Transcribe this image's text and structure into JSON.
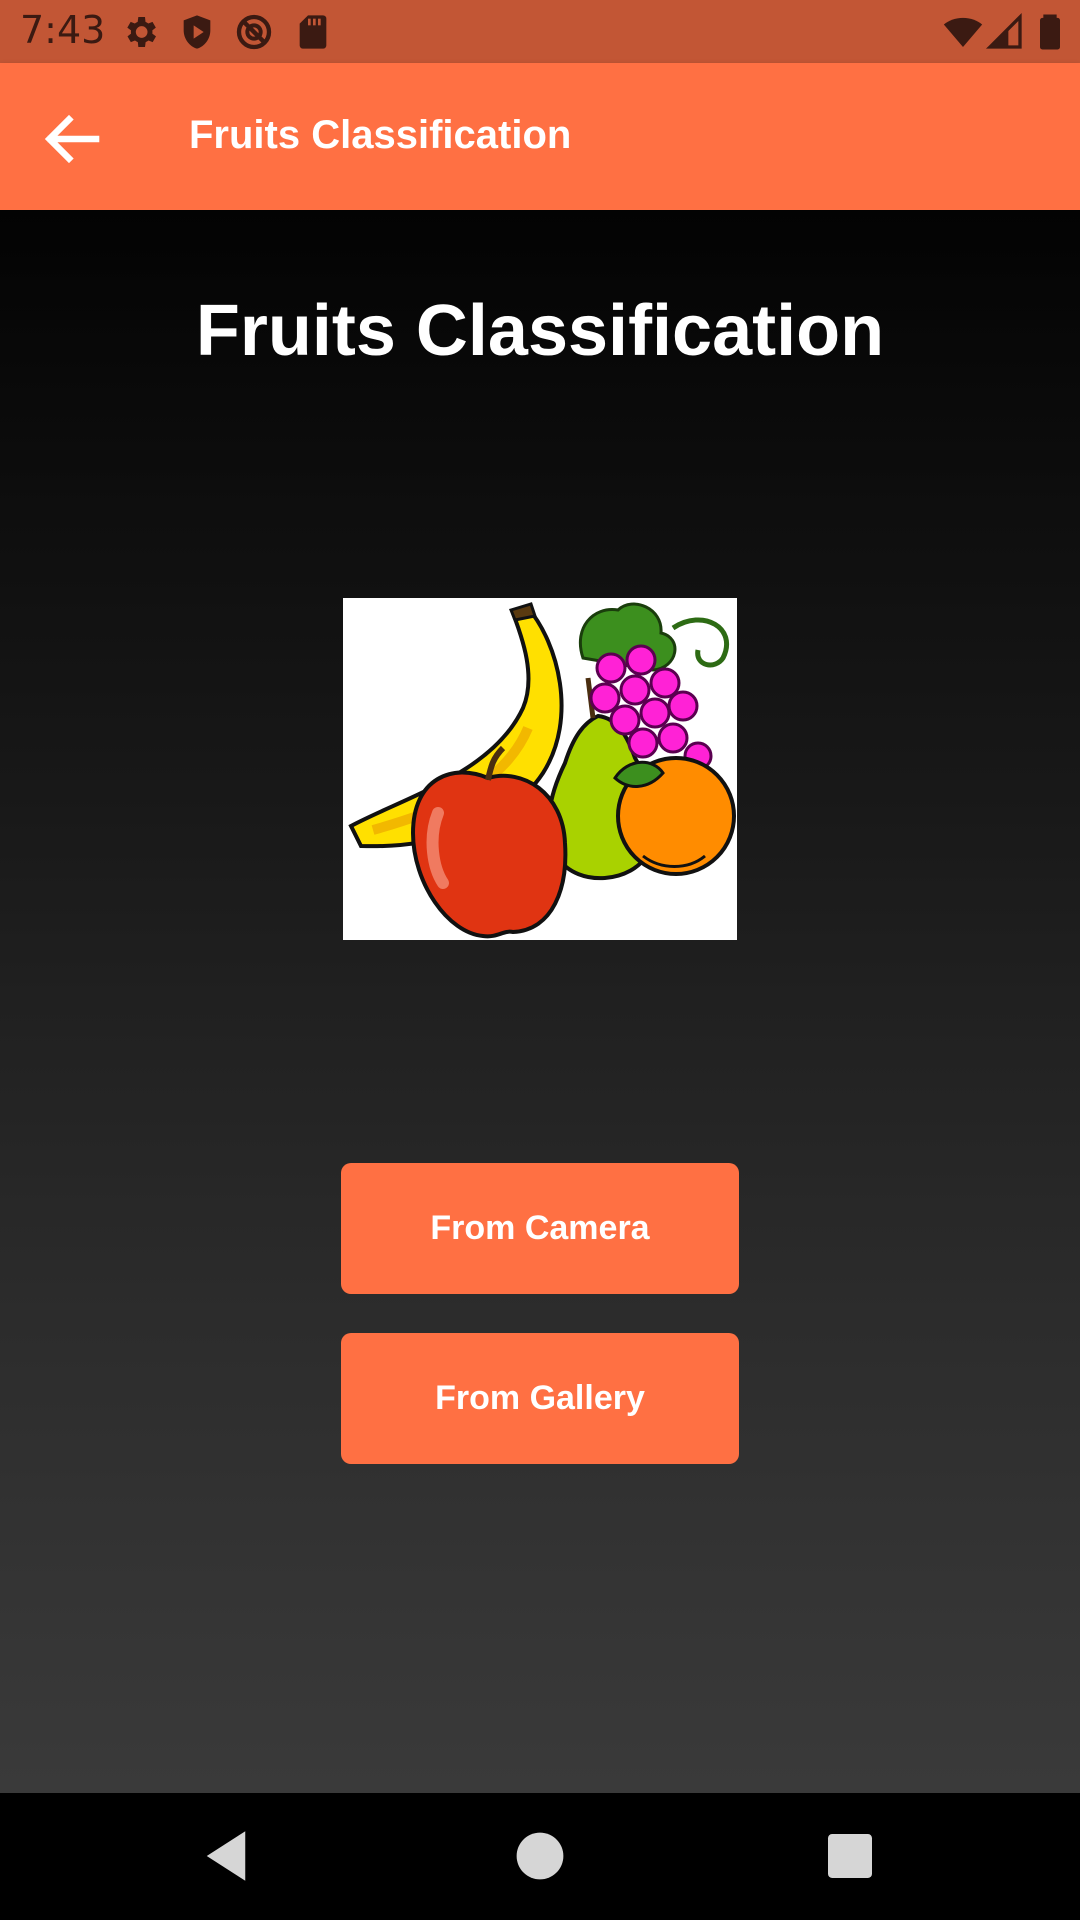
{
  "status_bar": {
    "time": "7:43",
    "icons": [
      "gear-icon",
      "shield-play-icon",
      "blocked-circle-icon",
      "sd-card-icon",
      "wifi-icon",
      "signal-icon",
      "battery-icon"
    ]
  },
  "app_bar": {
    "title": "Fruits Classification",
    "back_icon": "arrow-back-icon",
    "color": "#FF7043"
  },
  "main": {
    "title": "Fruits Classification",
    "image": "fruits-illustration",
    "buttons": {
      "camera": "From Camera",
      "gallery": "From Gallery"
    },
    "accent": "#FF7043"
  },
  "nav_bar": {
    "icons": [
      "nav-back-icon",
      "nav-home-icon",
      "nav-recents-icon"
    ]
  }
}
